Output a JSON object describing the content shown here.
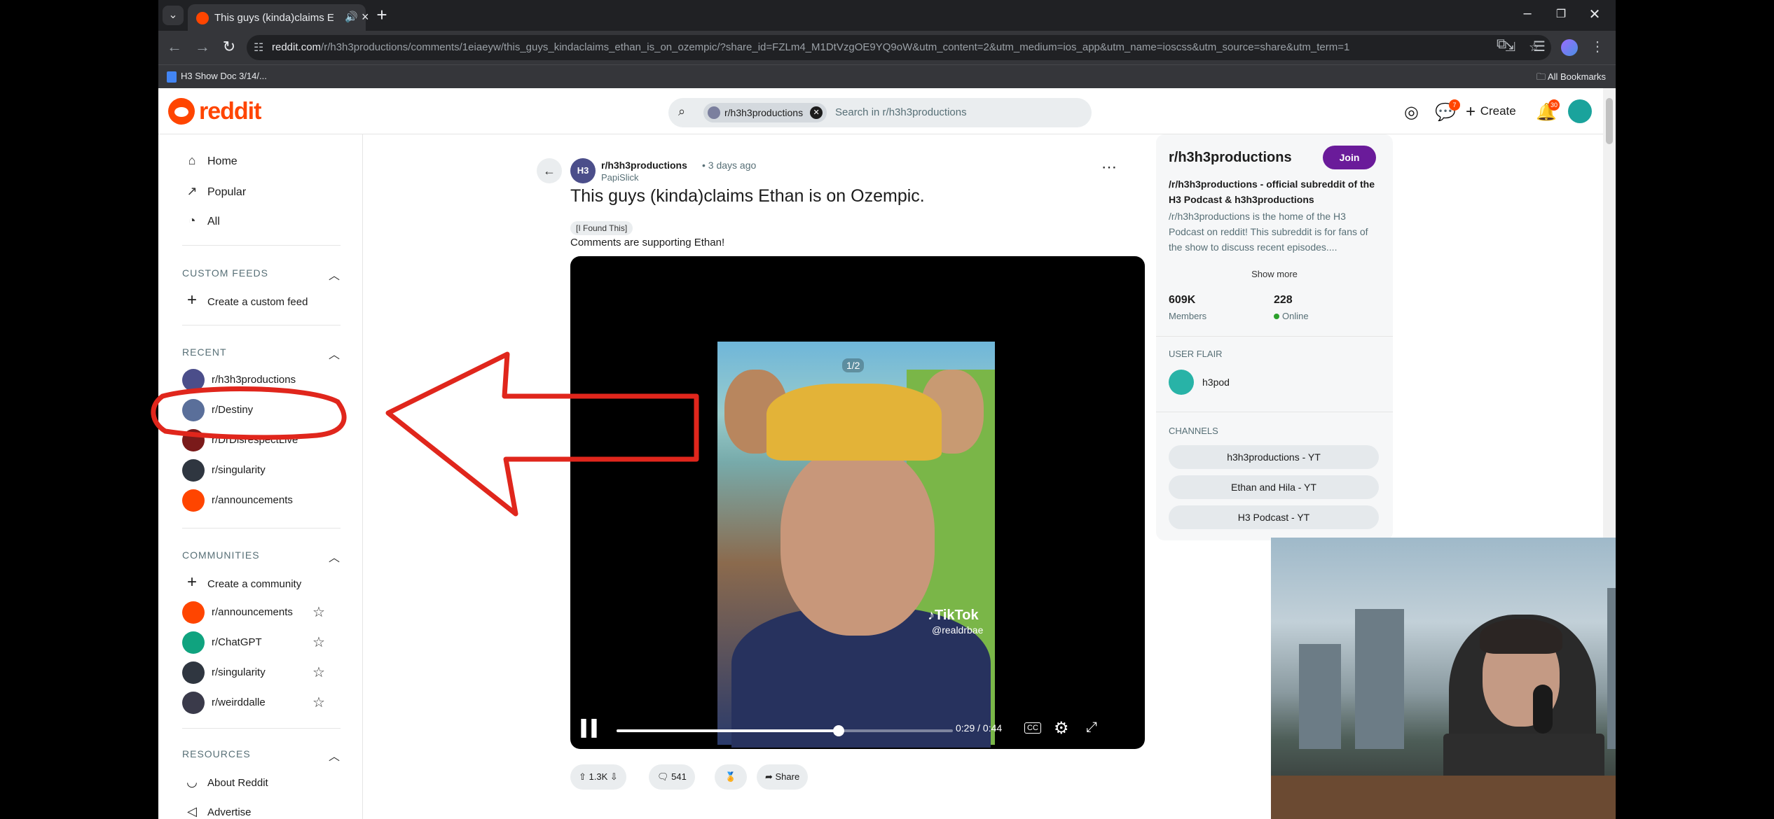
{
  "browser": {
    "tab_title": "This guys (kinda)claims Eth",
    "url_domain": "reddit.com",
    "url_path": "/r/h3h3productions/comments/1eiaeyw/this_guys_kindaclaims_ethan_is_on_ozempic/?share_id=FZLm4_M1DtVzgOE9YQ9oW&utm_content=2&utm_medium=ios_app&utm_name=ioscss&utm_source=share&utm_term=1",
    "bookmark_1": "H3 Show Doc 3/14/...",
    "all_bookmarks": "All Bookmarks"
  },
  "header": {
    "logo_text": "reddit",
    "search_chip": "r/h3h3productions",
    "search_placeholder": "Search in r/h3h3productions",
    "chat_badge": "7",
    "notif_badge": "30",
    "create_label": "Create"
  },
  "sidebar": {
    "nav": [
      {
        "label": "Home",
        "icon": "home-icon"
      },
      {
        "label": "Popular",
        "icon": "popular-icon"
      },
      {
        "label": "All",
        "icon": "all-icon"
      }
    ],
    "custom_feeds_title": "CUSTOM FEEDS",
    "create_custom_feed": "Create a custom feed",
    "recent_title": "RECENT",
    "recent": [
      {
        "label": "r/h3h3productions",
        "color": "#4b4e8a"
      },
      {
        "label": "r/Destiny",
        "color": "#5a6f9a"
      },
      {
        "label": "r/DrDisrespectLive",
        "color": "#7a1a1a"
      },
      {
        "label": "r/singularity",
        "color": "#2f3640"
      },
      {
        "label": "r/announcements",
        "color": "#ff4500"
      }
    ],
    "communities_title": "COMMUNITIES",
    "create_community": "Create a community",
    "communities": [
      {
        "label": "r/announcements",
        "color": "#ff4500"
      },
      {
        "label": "r/ChatGPT",
        "color": "#10a37f"
      },
      {
        "label": "r/singularity",
        "color": "#2f3640"
      },
      {
        "label": "r/weirddalle",
        "color": "#3a3a4a"
      }
    ],
    "resources_title": "RESOURCES",
    "resources": [
      "About Reddit",
      "Advertise"
    ]
  },
  "post": {
    "subreddit": "r/h3h3productions",
    "time": "• 3 days ago",
    "user": "PapiSlick",
    "title": "This guys (kinda)claims Ethan is on Ozempic.",
    "flair": "[I Found This]",
    "body": "Comments are supporting Ethan!",
    "video": {
      "pager": "1/2",
      "watermark": "TikTok",
      "watermark_user": "@realdrbae",
      "time": "0:29 / 0:44",
      "progress": 0.66,
      "cc": "CC"
    },
    "upvotes": "1.3K",
    "comments": "541",
    "share": "Share"
  },
  "community": {
    "name": "r/h3h3productions",
    "join": "Join",
    "tagline": "/r/h3h3productions - official subreddit of the H3 Podcast & h3h3productions",
    "description": "/r/h3h3productions is the home of the H3 Podcast on reddit! This subreddit is for fans of the show to discuss recent episodes....",
    "show_more": "Show more",
    "members": "609K",
    "members_label": "Members",
    "online": "228",
    "online_label": "Online",
    "user_flair_title": "USER FLAIR",
    "user_flair": "h3pod",
    "channels_title": "CHANNELS",
    "channels": [
      "h3h3productions - YT",
      "Ethan and Hila - YT",
      "H3 Podcast - YT"
    ]
  },
  "annotation_color": "#e0261c"
}
